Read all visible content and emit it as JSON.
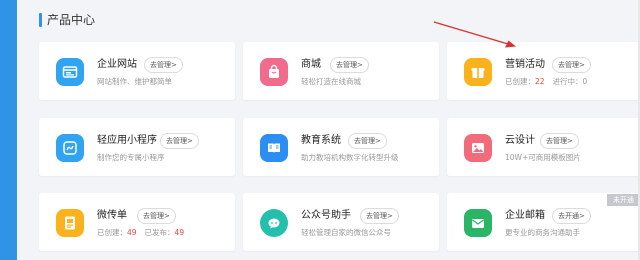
{
  "section": {
    "title": "产品中心"
  },
  "cards": [
    {
      "title": "企业网站",
      "button": "去管理>",
      "desc": "网站制作、维护都简单",
      "icon": "website-icon",
      "color": "#31a4f1"
    },
    {
      "title": "商城",
      "button": "去管理>",
      "desc": "轻松打造在线商城",
      "icon": "shop-bag-icon",
      "color": "#f16b8d"
    },
    {
      "title": "营销活动",
      "button": "去管理>",
      "icon": "gift-icon",
      "color": "#fbb21c",
      "stats": {
        "created_label": "已创建：",
        "created_value": "22",
        "ongoing_label": "进行中：",
        "ongoing_value": "0"
      }
    },
    {
      "title": "轻应用小程序",
      "button": "去管理>",
      "desc": "制作您的专属小程序",
      "icon": "mini-program-icon",
      "color": "#31a4f1"
    },
    {
      "title": "教育系统",
      "button": "去管理>",
      "desc": "助力教培机构数字化转型升级",
      "icon": "book-icon",
      "color": "#2b8ef0"
    },
    {
      "title": "云设计",
      "button": "去管理>",
      "desc": "10W+可商用模板图片",
      "icon": "image-icon",
      "color": "#f16b7a"
    },
    {
      "title": "微传单",
      "button": "去管理>",
      "icon": "flyer-icon",
      "color": "#fbb21c",
      "stats": {
        "created_label": "已创建：",
        "created_value": "49",
        "published_label": "已发布：",
        "published_value": "49"
      }
    },
    {
      "title": "公众号助手",
      "button": "去管理>",
      "desc": "轻松管理自家的微信公众号",
      "icon": "wechat-icon",
      "color": "#25bfae"
    },
    {
      "title": "企业邮箱",
      "button": "去开通>",
      "desc": "更专业的商务沟通助手",
      "icon": "mail-icon",
      "color": "#2bb567"
    }
  ],
  "badge": {
    "not_open": "未开通"
  }
}
